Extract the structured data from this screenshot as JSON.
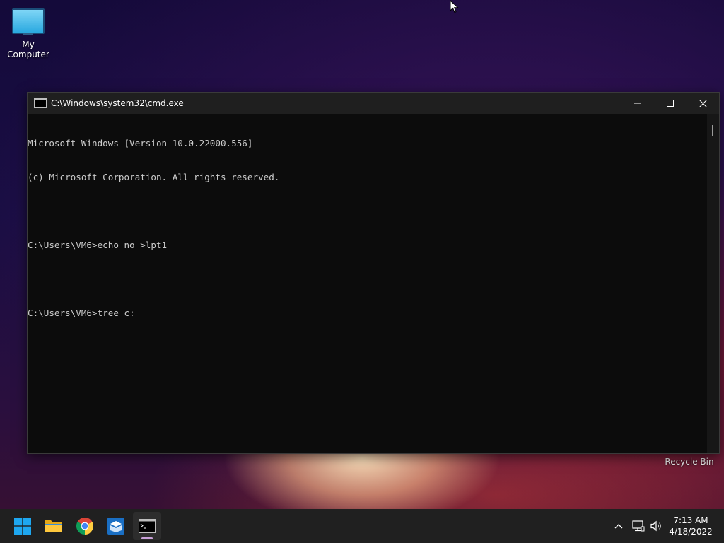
{
  "desktop": {
    "icons": [
      {
        "label": "My Computer",
        "icon": "monitor-icon"
      },
      {
        "label": "Recycle Bin",
        "icon": "recycle-bin-icon"
      }
    ]
  },
  "window": {
    "title": "C:\\Windows\\system32\\cmd.exe",
    "icon": "cmd-icon",
    "controls": {
      "minimize": "minimize-icon",
      "maximize": "maximize-icon",
      "close": "close-icon"
    },
    "lines": [
      "Microsoft Windows [Version 10.0.22000.556]",
      "(c) Microsoft Corporation. All rights reserved.",
      "",
      "C:\\Users\\VM6>echo no >lpt1",
      "",
      "C:\\Users\\VM6>tree c:"
    ]
  },
  "taskbar": {
    "apps": [
      {
        "name": "start",
        "icon": "windows-start-icon"
      },
      {
        "name": "file-explorer",
        "icon": "folder-icon"
      },
      {
        "name": "chrome",
        "icon": "chrome-icon"
      },
      {
        "name": "app",
        "icon": "box-app-icon"
      },
      {
        "name": "command-prompt",
        "icon": "terminal-icon",
        "active": true
      }
    ],
    "tray": {
      "icons": [
        "chevron-up-icon",
        "network-icon",
        "volume-icon"
      ],
      "time": "7:13 AM",
      "date": "4/18/2022"
    }
  },
  "colors": {
    "console_bg": "#0c0c0c",
    "console_fg": "#cccccc",
    "titlebar_bg": "#1f1f1f",
    "taskbar_bg": "#202020"
  }
}
